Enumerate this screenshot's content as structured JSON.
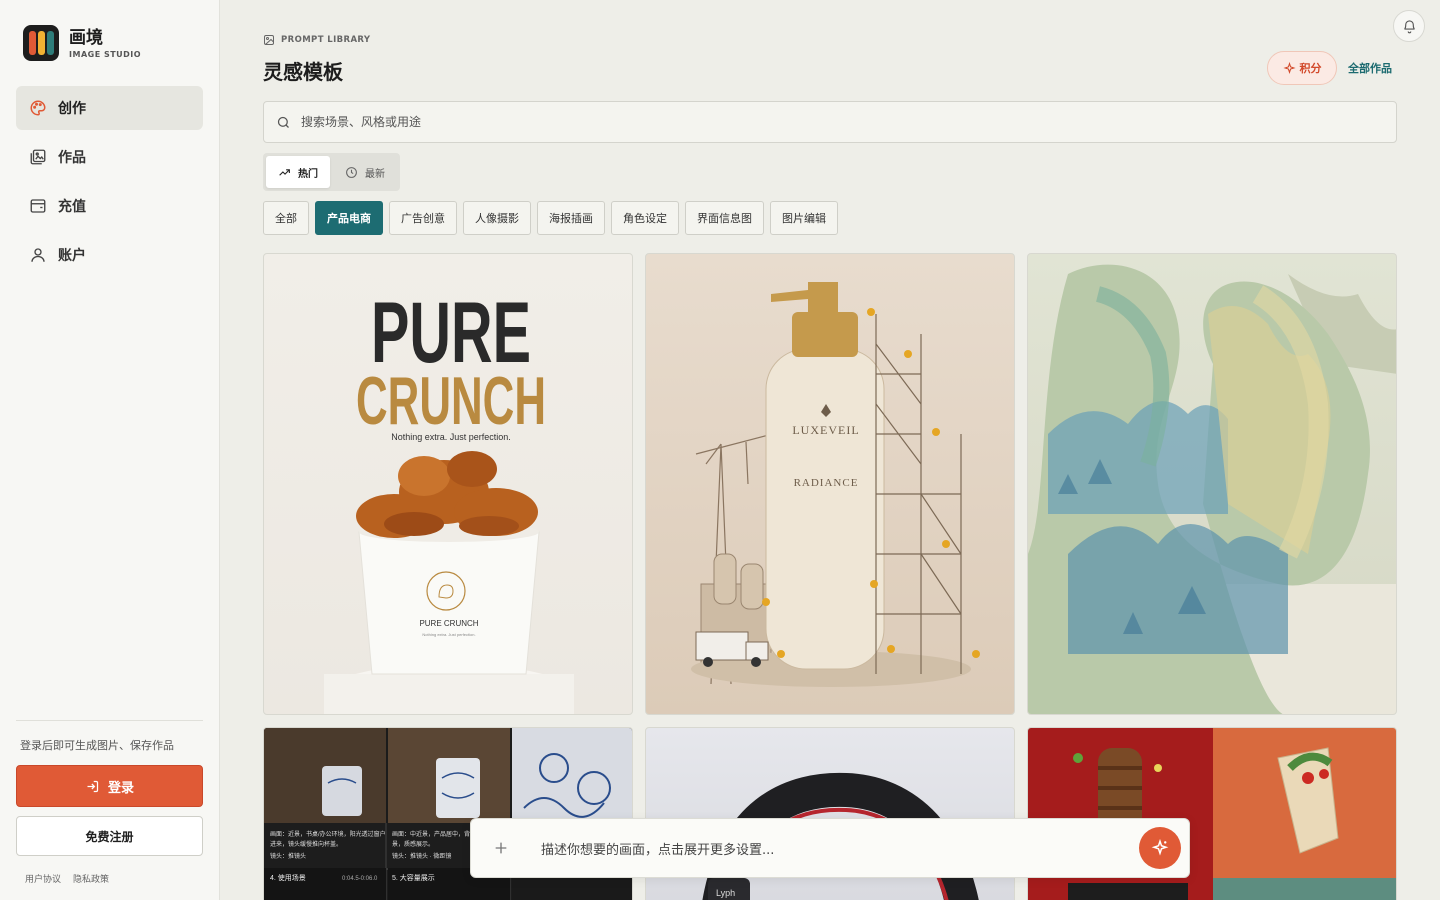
{
  "brand": {
    "title": "画境",
    "subtitle": "IMAGE STUDIO",
    "colors": [
      "#e05a36",
      "#f2b233",
      "#2e7d7a"
    ]
  },
  "sidebar": {
    "items": [
      {
        "label": "创作",
        "icon": "palette-icon",
        "active": true
      },
      {
        "label": "作品",
        "icon": "gallery-icon",
        "active": false
      },
      {
        "label": "充值",
        "icon": "wallet-icon",
        "active": false
      },
      {
        "label": "账户",
        "icon": "user-icon",
        "active": false
      }
    ],
    "login_hint": "登录后即可生成图片、保存作品",
    "login_label": "登录",
    "register_label": "免费注册",
    "terms_label": "用户协议",
    "privacy_label": "隐私政策"
  },
  "header": {
    "eyebrow": "PROMPT LIBRARY",
    "title": "灵感模板",
    "points_label": "积分",
    "all_works_label": "全部作品"
  },
  "search": {
    "placeholder": "搜索场景、风格或用途"
  },
  "sort": {
    "hot_label": "热门",
    "new_label": "最新",
    "selected": "热门"
  },
  "categories": [
    "全部",
    "产品电商",
    "广告创意",
    "人像摄影",
    "海报插画",
    "角色设定",
    "界面信息图",
    "图片编辑"
  ],
  "selected_category": "产品电商",
  "cards": {
    "crunch": {
      "headline1": "PURE",
      "headline2": "CRUNCH",
      "tagline": "Nothing extra. Just perfection.",
      "bucket_label": "PURE CRUNCH",
      "bucket_small": "Nothing extra. Just perfection."
    },
    "bottle": {
      "brand": "LUXEVEIL",
      "product": "RADIANCE"
    },
    "storyboard": {
      "cap1": "4. 使用场景",
      "cap2": "5. 大容量展示"
    },
    "headphone": {
      "label": "Lyph"
    }
  },
  "composer": {
    "placeholder": "描述你想要的画面，点击展开更多设置..."
  },
  "accent": {
    "primary": "#e05a36",
    "teal": "#1d6c72"
  }
}
